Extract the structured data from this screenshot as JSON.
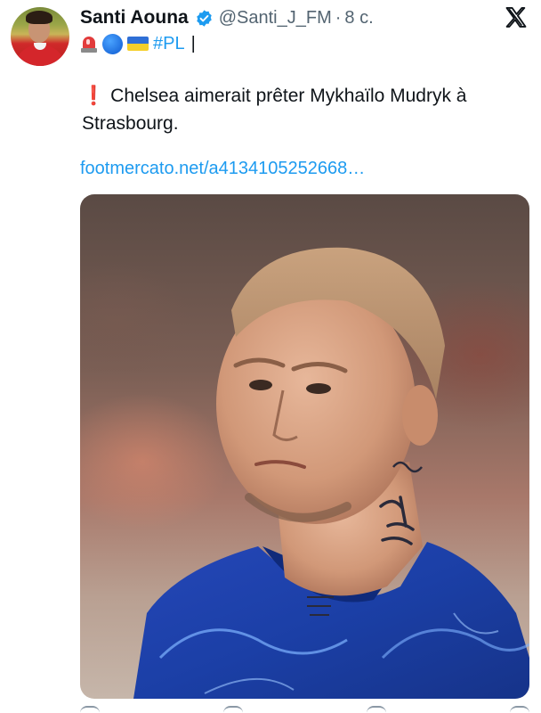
{
  "author": {
    "display_name": "Santi Aouna",
    "handle": "@Santi_J_FM",
    "separator": "·",
    "time": "8 с."
  },
  "bio": {
    "icons": [
      "police-light-emoji",
      "blue-circle-emoji",
      "ukraine-flag-emoji"
    ],
    "hashtag": "#PL",
    "trailing": "|"
  },
  "tweet": {
    "alert_icon": "❗",
    "text": "Chelsea aimerait prêter Mykhaïlo Mudryk à Strasbourg.",
    "link": "footmercato.net/a4134105252668…"
  },
  "colors": {
    "link": "#1d9bf0",
    "secondary_text": "#536471",
    "verified": "#1d9bf0",
    "jersey": "#1b3fa6"
  }
}
